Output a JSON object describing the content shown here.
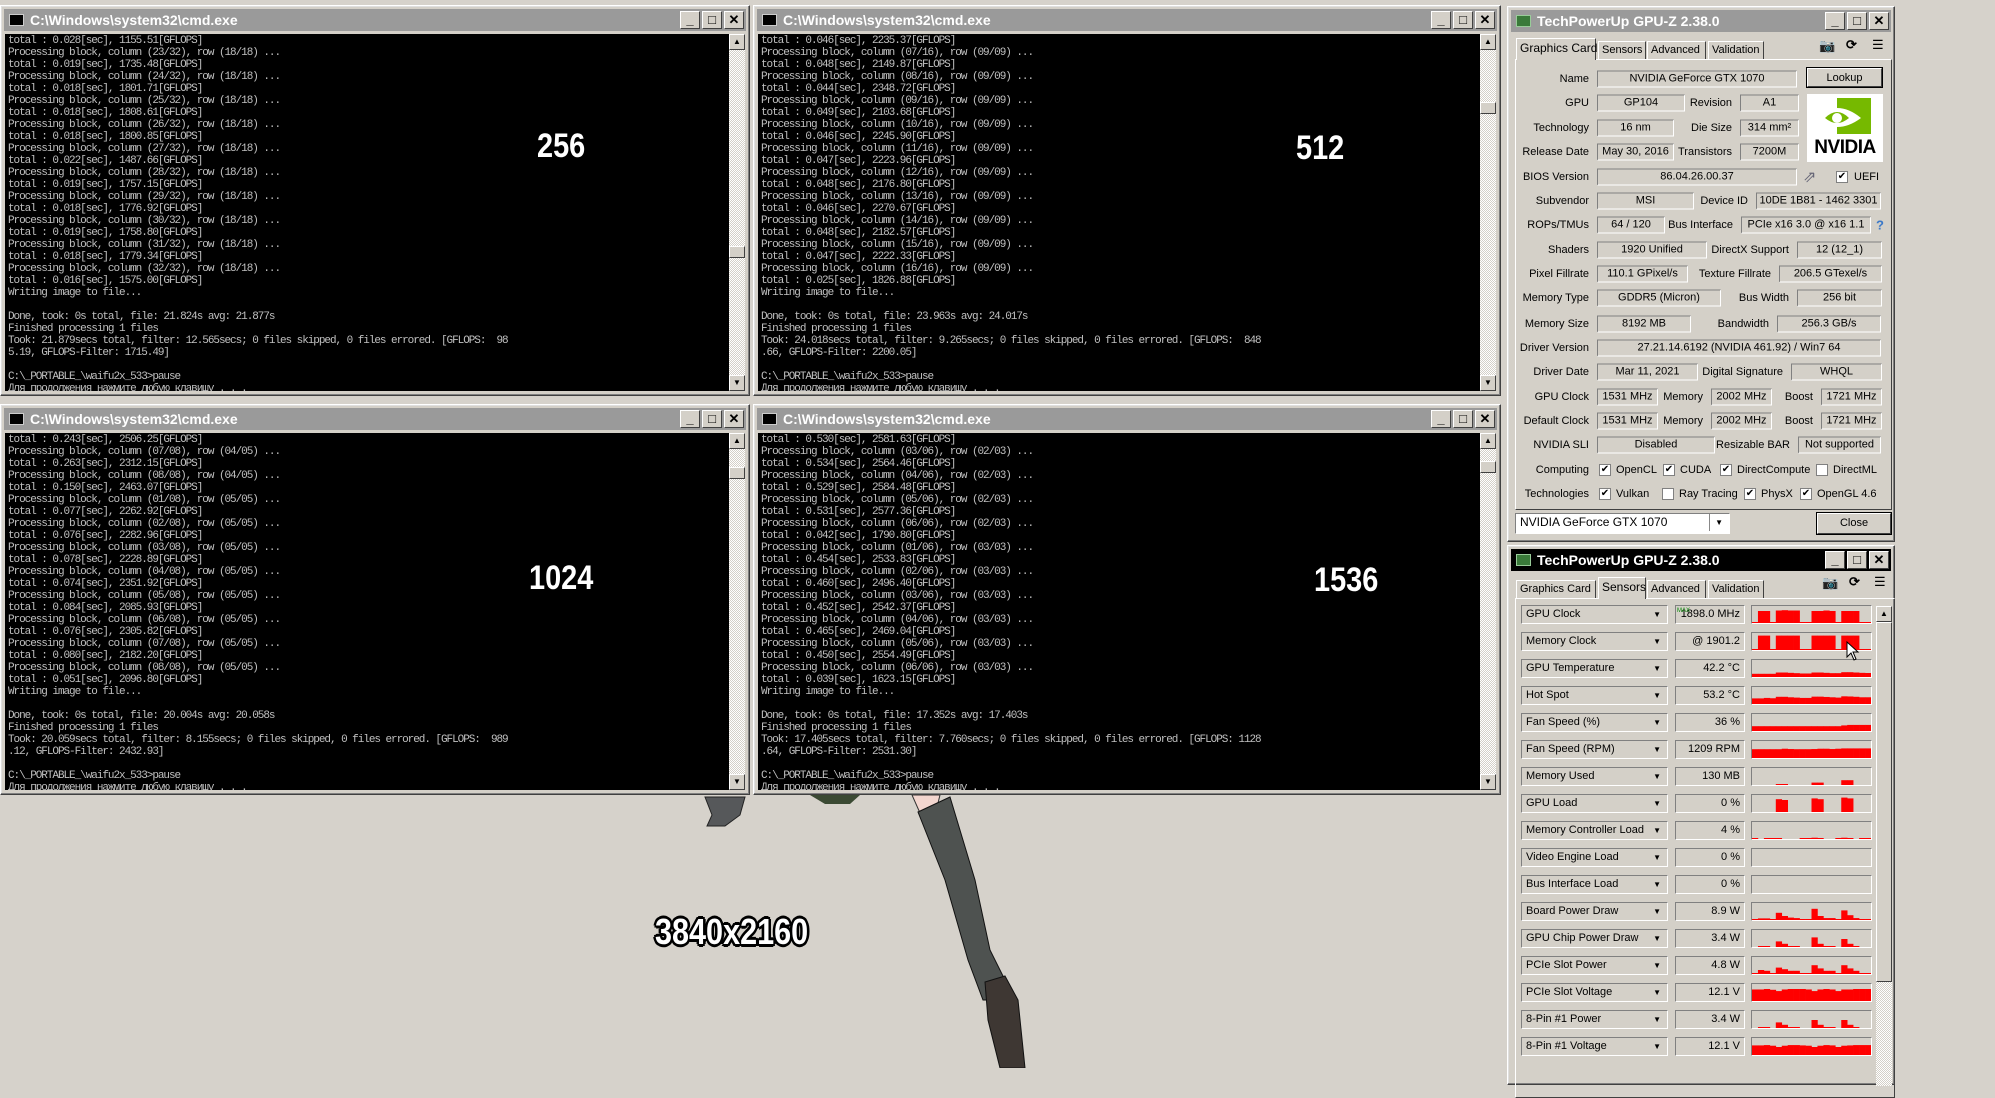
{
  "consoles": [
    {
      "title": "C:\\Windows\\system32\\cmd.exe",
      "overlay": "256",
      "scroll_fraction": 0.64,
      "lines": [
        "total : 0.028[sec], 1155.51[GFLOPS]",
        "Processing block, column (23/32), row (18/18) ...",
        "total : 0.019[sec], 1735.48[GFLOPS]",
        "Processing block, column (24/32), row (18/18) ...",
        "total : 0.018[sec], 1801.71[GFLOPS]",
        "Processing block, column (25/32), row (18/18) ...",
        "total : 0.018[sec], 1808.61[GFLOPS]",
        "Processing block, column (26/32), row (18/18) ...",
        "total : 0.018[sec], 1800.85[GFLOPS]",
        "Processing block, column (27/32), row (18/18) ...",
        "total : 0.022[sec], 1487.66[GFLOPS]",
        "Processing block, column (28/32), row (18/18) ...",
        "total : 0.019[sec], 1757.15[GFLOPS]",
        "Processing block, column (29/32), row (18/18) ...",
        "total : 0.018[sec], 1776.92[GFLOPS]",
        "Processing block, column (30/32), row (18/18) ...",
        "total : 0.019[sec], 1758.80[GFLOPS]",
        "Processing block, column (31/32), row (18/18) ...",
        "total : 0.018[sec], 1779.34[GFLOPS]",
        "Processing block, column (32/32), row (18/18) ...",
        "total : 0.016[sec], 1575.00[GFLOPS]",
        "Writing image to file...",
        "",
        "Done, took: 0s total, file: 21.824s avg: 21.877s",
        "Finished processing 1 files",
        "Took: 21.879secs total, filter: 12.565secs; 0 files skipped, 0 files errored. [GFLOPS:  98",
        "5.19, GFLOPS-Filter: 1715.49]",
        "",
        "C:\\_PORTABLE_\\waifu2x_533>pause",
        "Для продолжения нажмите любую клавишу . . ."
      ]
    },
    {
      "title": "C:\\Windows\\system32\\cmd.exe",
      "overlay": "512",
      "scroll_fraction": 0.17,
      "lines": [
        "total : 0.046[sec], 2235.37[GFLOPS]",
        "Processing block, column (07/16), row (09/09) ...",
        "total : 0.048[sec], 2149.87[GFLOPS]",
        "Processing block, column (08/16), row (09/09) ...",
        "total : 0.044[sec], 2348.72[GFLOPS]",
        "Processing block, column (09/16), row (09/09) ...",
        "total : 0.049[sec], 2103.68[GFLOPS]",
        "Processing block, column (10/16), row (09/09) ...",
        "total : 0.046[sec], 2245.90[GFLOPS]",
        "Processing block, column (11/16), row (09/09) ...",
        "total : 0.047[sec], 2223.96[GFLOPS]",
        "Processing block, column (12/16), row (09/09) ...",
        "total : 0.048[sec], 2176.80[GFLOPS]",
        "Processing block, column (13/16), row (09/09) ...",
        "total : 0.046[sec], 2270.67[GFLOPS]",
        "Processing block, column (14/16), row (09/09) ...",
        "total : 0.048[sec], 2182.57[GFLOPS]",
        "Processing block, column (15/16), row (09/09) ...",
        "total : 0.047[sec], 2222.33[GFLOPS]",
        "Processing block, column (16/16), row (09/09) ...",
        "total : 0.025[sec], 1826.88[GFLOPS]",
        "Writing image to file...",
        "",
        "Done, took: 0s total, file: 23.963s avg: 24.017s",
        "Finished processing 1 files",
        "Took: 24.018secs total, filter: 9.265secs; 0 files skipped, 0 files errored. [GFLOPS:  848",
        ".66, GFLOPS-Filter: 2200.05]",
        "",
        "C:\\_PORTABLE_\\waifu2x_533>pause",
        "Для продолжения нажмите любую клавишу . . ."
      ]
    },
    {
      "title": "C:\\Windows\\system32\\cmd.exe",
      "overlay": "1024",
      "scroll_fraction": 0.06,
      "lines": [
        "total : 0.243[sec], 2506.25[GFLOPS]",
        "Processing block, column (07/08), row (04/05) ...",
        "total : 0.263[sec], 2312.15[GFLOPS]",
        "Processing block, column (08/08), row (04/05) ...",
        "total : 0.150[sec], 2463.07[GFLOPS]",
        "Processing block, column (01/08), row (05/05) ...",
        "total : 0.077[sec], 2262.92[GFLOPS]",
        "Processing block, column (02/08), row (05/05) ...",
        "total : 0.076[sec], 2282.96[GFLOPS]",
        "Processing block, column (03/08), row (05/05) ...",
        "total : 0.078[sec], 2228.89[GFLOPS]",
        "Processing block, column (04/08), row (05/05) ...",
        "total : 0.074[sec], 2351.92[GFLOPS]",
        "Processing block, column (05/08), row (05/05) ...",
        "total : 0.084[sec], 2085.93[GFLOPS]",
        "Processing block, column (06/08), row (05/05) ...",
        "total : 0.076[sec], 2305.82[GFLOPS]",
        "Processing block, column (07/08), row (05/05) ...",
        "total : 0.080[sec], 2182.20[GFLOPS]",
        "Processing block, column (08/08), row (05/05) ...",
        "total : 0.051[sec], 2096.80[GFLOPS]",
        "Writing image to file...",
        "",
        "Done, took: 0s total, file: 20.004s avg: 20.058s",
        "Finished processing 1 files",
        "Took: 20.059secs total, filter: 8.155secs; 0 files skipped, 0 files errored. [GFLOPS:  989",
        ".12, GFLOPS-Filter: 2432.93]",
        "",
        "C:\\_PORTABLE_\\waifu2x_533>pause",
        "Для продолжения нажмите любую клавишу . . ."
      ]
    },
    {
      "title": "C:\\Windows\\system32\\cmd.exe",
      "overlay": "1536",
      "scroll_fraction": 0.04,
      "lines": [
        "total : 0.530[sec], 2581.63[GFLOPS]",
        "Processing block, column (03/06), row (02/03) ...",
        "total : 0.534[sec], 2564.46[GFLOPS]",
        "Processing block, column (04/06), row (02/03) ...",
        "total : 0.529[sec], 2584.48[GFLOPS]",
        "Processing block, column (05/06), row (02/03) ...",
        "total : 0.531[sec], 2577.36[GFLOPS]",
        "Processing block, column (06/06), row (02/03) ...",
        "total : 0.042[sec], 1790.80[GFLOPS]",
        "Processing block, column (01/06), row (03/03) ...",
        "total : 0.454[sec], 2533.83[GFLOPS]",
        "Processing block, column (02/06), row (03/03) ...",
        "total : 0.460[sec], 2496.40[GFLOPS]",
        "Processing block, column (03/06), row (03/03) ...",
        "total : 0.452[sec], 2542.37[GFLOPS]",
        "Processing block, column (04/06), row (03/03) ...",
        "total : 0.465[sec], 2469.04[GFLOPS]",
        "Processing block, column (05/06), row (03/03) ...",
        "total : 0.450[sec], 2554.49[GFLOPS]",
        "Processing block, column (06/06), row (03/03) ...",
        "total : 0.039[sec], 1623.15[GFLOPS]",
        "Writing image to file...",
        "",
        "Done, took: 0s total, file: 17.352s avg: 17.403s",
        "Finished processing 1 files",
        "Took: 17.405secs total, filter: 7.760secs; 0 files skipped, 0 files errored. [GFLOPS: 1128",
        ".64, GFLOPS-Filter: 2531.30]",
        "",
        "C:\\_PORTABLE_\\waifu2x_533>pause",
        "Для продолжения нажмите любую клавишу . . ."
      ]
    }
  ],
  "resolution_label": "3840x2160",
  "card": {
    "title": "TechPowerUp GPU-Z 2.38.0",
    "tabs": [
      "Graphics Card",
      "Sensors",
      "Advanced",
      "Validation"
    ],
    "lookup": "Lookup",
    "logo_text": "NVIDIA",
    "fields": {
      "name": {
        "label": "Name",
        "value": "NVIDIA GeForce GTX 1070"
      },
      "gpu": {
        "label": "GPU",
        "value": "GP104"
      },
      "revision": {
        "label": "Revision",
        "value": "A1"
      },
      "technology": {
        "label": "Technology",
        "value": "16 nm"
      },
      "die_size": {
        "label": "Die Size",
        "value": "314 mm²"
      },
      "release_date": {
        "label": "Release Date",
        "value": "May 30, 2016"
      },
      "transistors": {
        "label": "Transistors",
        "value": "7200M"
      },
      "bios_version": {
        "label": "BIOS Version",
        "value": "86.04.26.00.37"
      },
      "subvendor": {
        "label": "Subvendor",
        "value": "MSI"
      },
      "device_id": {
        "label": "Device ID",
        "value": "10DE 1B81 - 1462 3301"
      },
      "rops_tmus": {
        "label": "ROPs/TMUs",
        "value": "64 / 120"
      },
      "bus_interface": {
        "label": "Bus Interface",
        "value": "PCIe x16 3.0 @ x16 1.1"
      },
      "shaders": {
        "label": "Shaders",
        "value": "1920 Unified"
      },
      "directx": {
        "label": "DirectX Support",
        "value": "12 (12_1)"
      },
      "pixel_fillrate": {
        "label": "Pixel Fillrate",
        "value": "110.1 GPixel/s"
      },
      "texture_fillrate": {
        "label": "Texture Fillrate",
        "value": "206.5 GTexel/s"
      },
      "memory_type": {
        "label": "Memory Type",
        "value": "GDDR5 (Micron)"
      },
      "bus_width": {
        "label": "Bus Width",
        "value": "256 bit"
      },
      "memory_size": {
        "label": "Memory Size",
        "value": "8192 MB"
      },
      "bandwidth": {
        "label": "Bandwidth",
        "value": "256.3 GB/s"
      },
      "driver_version": {
        "label": "Driver Version",
        "value": "27.21.14.6192 (NVIDIA 461.92) / Win7 64"
      },
      "driver_date": {
        "label": "Driver Date",
        "value": "Mar 11, 2021"
      },
      "digital_signature": {
        "label": "Digital Signature",
        "value": "WHQL"
      },
      "gpu_clock": {
        "label": "GPU Clock",
        "value": "1531 MHz"
      },
      "memory_clock": {
        "label": "Memory",
        "value": "2002 MHz"
      },
      "boost_clock": {
        "label": "Boost",
        "value": "1721 MHz"
      },
      "default_clock": {
        "label": "Default Clock",
        "value": "1531 MHz"
      },
      "default_memory": {
        "label": "Memory",
        "value": "2002 MHz"
      },
      "default_boost": {
        "label": "Boost",
        "value": "1721 MHz"
      },
      "nvidia_sli": {
        "label": "NVIDIA SLI",
        "value": "Disabled"
      },
      "resizable_bar": {
        "label": "Resizable BAR",
        "value": "Not supported"
      }
    },
    "uefi": {
      "label": "UEFI",
      "checked": true
    },
    "computing": {
      "label": "Computing",
      "items": [
        {
          "label": "OpenCL",
          "checked": true
        },
        {
          "label": "CUDA",
          "checked": true
        },
        {
          "label": "DirectCompute",
          "checked": true
        },
        {
          "label": "DirectML",
          "checked": false
        }
      ]
    },
    "technologies": {
      "label": "Technologies",
      "items": [
        {
          "label": "Vulkan",
          "checked": true
        },
        {
          "label": "Ray Tracing",
          "checked": false
        },
        {
          "label": "PhysX",
          "checked": true
        },
        {
          "label": "OpenGL 4.6",
          "checked": true
        }
      ]
    },
    "gpu_select": "NVIDIA GeForce GTX 1070",
    "close": "Close"
  },
  "sensors": {
    "title": "TechPowerUp GPU-Z 2.38.0",
    "tabs": [
      "Graphics Card",
      "Sensors",
      "Advanced",
      "Validation"
    ],
    "max_tag": "MAX",
    "graph_color": "#ff0000",
    "rows": [
      {
        "name": "GPU Clock",
        "value": "1898.0 MHz",
        "max": true,
        "history": [
          0.05,
          0.75,
          0.75,
          0.05,
          0.78,
          0.8,
          0.78,
          0.78,
          0.05,
          0.05,
          0.75,
          0.75,
          0.78,
          0.75,
          0.05,
          0.75,
          0.75,
          0.75,
          0.05,
          0.05
        ]
      },
      {
        "name": "Memory Clock",
        "value": "@ 1901.2",
        "history": [
          0.05,
          0.9,
          0.9,
          0.05,
          0.9,
          0.9,
          0.9,
          0.9,
          0.05,
          0.05,
          0.9,
          0.9,
          0.9,
          0.9,
          0.05,
          0.9,
          0.9,
          0.9,
          0.05,
          0.05
        ]
      },
      {
        "name": "GPU Temperature",
        "value": "42.2 °C",
        "history": [
          0.2,
          0.2,
          0.2,
          0.2,
          0.28,
          0.28,
          0.26,
          0.24,
          0.22,
          0.22,
          0.28,
          0.28,
          0.26,
          0.24,
          0.24,
          0.3,
          0.3,
          0.28,
          0.26,
          0.25
        ]
      },
      {
        "name": "Hot Spot",
        "value": "53.2 °C",
        "history": [
          0.35,
          0.35,
          0.38,
          0.36,
          0.45,
          0.45,
          0.42,
          0.4,
          0.38,
          0.38,
          0.46,
          0.46,
          0.44,
          0.42,
          0.4,
          0.48,
          0.47,
          0.45,
          0.42,
          0.42
        ]
      },
      {
        "name": "Fan Speed (%)",
        "value": "36 %",
        "history": [
          0.3,
          0.3,
          0.3,
          0.3,
          0.3,
          0.3,
          0.3,
          0.3,
          0.3,
          0.3,
          0.3,
          0.3,
          0.3,
          0.3,
          0.3,
          0.35,
          0.38,
          0.38,
          0.38,
          0.38
        ]
      },
      {
        "name": "Fan Speed (RPM)",
        "value": "1209 RPM",
        "history": [
          0.55,
          0.55,
          0.55,
          0.55,
          0.55,
          0.58,
          0.56,
          0.55,
          0.55,
          0.55,
          0.56,
          0.58,
          0.58,
          0.56,
          0.58,
          0.6,
          0.6,
          0.6,
          0.6,
          0.6
        ]
      },
      {
        "name": "Memory Used",
        "value": "130 MB",
        "history": [
          0,
          0,
          0,
          0,
          0.05,
          0.05,
          0,
          0,
          0,
          0,
          0.15,
          0.15,
          0,
          0,
          0,
          0.3,
          0.3,
          0,
          0,
          0
        ]
      },
      {
        "name": "GPU Load",
        "value": "0 %",
        "history": [
          0,
          0,
          0,
          0,
          0.8,
          0.75,
          0,
          0,
          0,
          0,
          0.85,
          0.8,
          0,
          0,
          0,
          0.9,
          0.85,
          0,
          0,
          0
        ]
      },
      {
        "name": "Memory Controller Load",
        "value": "4 %",
        "history": [
          0.05,
          0,
          0.05,
          0.05,
          0.05,
          0,
          0,
          0,
          0.05,
          0.05,
          0.08,
          0.05,
          0,
          0,
          0.05,
          0.08,
          0.05,
          0,
          0.05,
          0.05
        ]
      },
      {
        "name": "Video Engine Load",
        "value": "0 %",
        "history": [
          0,
          0,
          0,
          0,
          0,
          0,
          0,
          0,
          0,
          0,
          0,
          0,
          0,
          0,
          0,
          0,
          0,
          0,
          0,
          0
        ]
      },
      {
        "name": "Bus Interface Load",
        "value": "0 %",
        "history": [
          0,
          0,
          0,
          0,
          0,
          0,
          0,
          0,
          0,
          0,
          0,
          0,
          0,
          0,
          0,
          0,
          0,
          0,
          0,
          0
        ]
      },
      {
        "name": "Board Power Draw",
        "value": "8.9 W",
        "history": [
          0.05,
          0.1,
          0.1,
          0.05,
          0.45,
          0.25,
          0.15,
          0.12,
          0.05,
          0.05,
          0.7,
          0.25,
          0.12,
          0.12,
          0.05,
          0.6,
          0.3,
          0.12,
          0.05,
          0.05
        ]
      },
      {
        "name": "GPU Chip Power Draw",
        "value": "3.4 W",
        "history": [
          0,
          0.05,
          0.05,
          0,
          0.35,
          0.2,
          0.05,
          0.05,
          0,
          0,
          0.6,
          0.2,
          0.05,
          0.05,
          0,
          0.5,
          0.2,
          0.05,
          0,
          0
        ]
      },
      {
        "name": "PCIe Slot Power",
        "value": "4.8 W",
        "history": [
          0.05,
          0.25,
          0.2,
          0.05,
          0.4,
          0.3,
          0.2,
          0.2,
          0.05,
          0.05,
          0.55,
          0.35,
          0.2,
          0.2,
          0.05,
          0.55,
          0.35,
          0.2,
          0.05,
          0.05
        ]
      },
      {
        "name": "PCIe Slot Voltage",
        "value": "12.1 V",
        "history": [
          0.72,
          0.72,
          0.75,
          0.7,
          0.62,
          0.72,
          0.75,
          0.75,
          0.75,
          0.72,
          0.62,
          0.72,
          0.75,
          0.72,
          0.62,
          0.72,
          0.72,
          0.75,
          0.75,
          0.75
        ]
      },
      {
        "name": "8-Pin #1 Power",
        "value": "3.4 W",
        "history": [
          0,
          0.05,
          0.05,
          0,
          0.35,
          0.2,
          0.05,
          0.05,
          0,
          0,
          0.5,
          0.2,
          0.05,
          0.05,
          0,
          0.5,
          0.2,
          0.05,
          0,
          0
        ]
      },
      {
        "name": "8-Pin #1 Voltage",
        "value": "12.1 V",
        "history": [
          0.6,
          0.6,
          0.62,
          0.58,
          0.5,
          0.58,
          0.62,
          0.62,
          0.6,
          0.58,
          0.5,
          0.58,
          0.62,
          0.6,
          0.5,
          0.58,
          0.6,
          0.62,
          0.62,
          0.62
        ]
      }
    ]
  }
}
